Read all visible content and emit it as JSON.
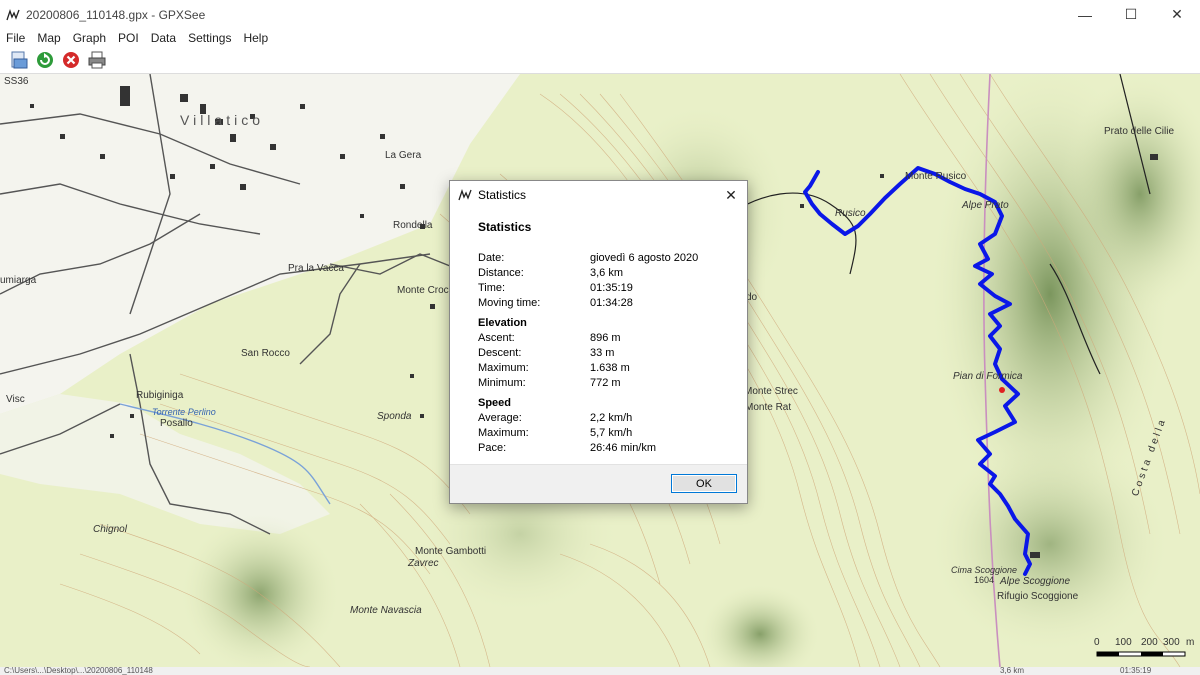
{
  "window": {
    "title": "20200806_110148.gpx - GPXSee",
    "minimize": "—",
    "maximize": "☐",
    "close": "✕"
  },
  "menu": [
    "File",
    "Map",
    "Graph",
    "POI",
    "Data",
    "Settings",
    "Help"
  ],
  "toolbar": {
    "open_icon": "open-file-icon",
    "reload_icon": "reload-icon",
    "close_icon": "close-file-icon",
    "print_icon": "print-icon"
  },
  "map": {
    "labels": {
      "ss36": "SS36",
      "villatico": "Villatico",
      "la_gera": "La Gera",
      "rondella": "Rondella",
      "pra_la_vacca": "Pra la Vacca",
      "umiarga": "umiarga",
      "monte_croci": "Monte Croci",
      "san_rocco": "San Rocco",
      "rubiginiga": "Rubiginiga",
      "torrente_perlino": "Torrente Perlino",
      "posallo": "Posallo",
      "visc": "Visc",
      "sponda": "Sponda",
      "chignol": "Chignol",
      "monte_gambotti": "Monte Gambotti",
      "zavrec": "Zavrec",
      "monte_navascia": "Monte Navascia",
      "rusico": "Rusico",
      "monte_rusico": "Monte Rusico",
      "alpe_prato": "Alpe Prato",
      "prato_delle_cilie": "Prato delle Cilie",
      "pian_di_formica": "Pian di Formica",
      "monte_strec": "Monte Strec",
      "monte_rat": "Monte Rat",
      "do": "do",
      "cima_scoggione": "Cima Scoggione",
      "cima_elev": "1604",
      "alpe_scoggione": "Alpe Scoggione",
      "rifugio_scoggione": "Rifugio Scoggione",
      "costa_della": "Costa della"
    },
    "scale": {
      "ticks": [
        "0",
        "100",
        "200",
        "300"
      ],
      "unit": "m"
    },
    "track_color": "#0000ee"
  },
  "status": {
    "path": "C:\\Users\\...\\Desktop\\...\\20200806_110148",
    "distance": "3,6 km",
    "time": "01:35:19"
  },
  "dialog": {
    "title": "Statistics",
    "heading": "Statistics",
    "general": [
      {
        "k": "Date:",
        "v": "giovedì 6 agosto 2020"
      },
      {
        "k": "Distance:",
        "v": "3,6 km"
      },
      {
        "k": "Time:",
        "v": "01:35:19"
      },
      {
        "k": "Moving time:",
        "v": "01:34:28"
      }
    ],
    "elevation_title": "Elevation",
    "elevation": [
      {
        "k": "Ascent:",
        "v": "896 m"
      },
      {
        "k": "Descent:",
        "v": "33 m"
      },
      {
        "k": "Maximum:",
        "v": "1.638 m"
      },
      {
        "k": "Minimum:",
        "v": "772 m"
      }
    ],
    "speed_title": "Speed",
    "speed": [
      {
        "k": "Average:",
        "v": "2,2 km/h"
      },
      {
        "k": "Maximum:",
        "v": "5,7 km/h"
      },
      {
        "k": "Pace:",
        "v": "26:46 min/km"
      }
    ],
    "ok_label": "OK",
    "close_glyph": "✕"
  }
}
